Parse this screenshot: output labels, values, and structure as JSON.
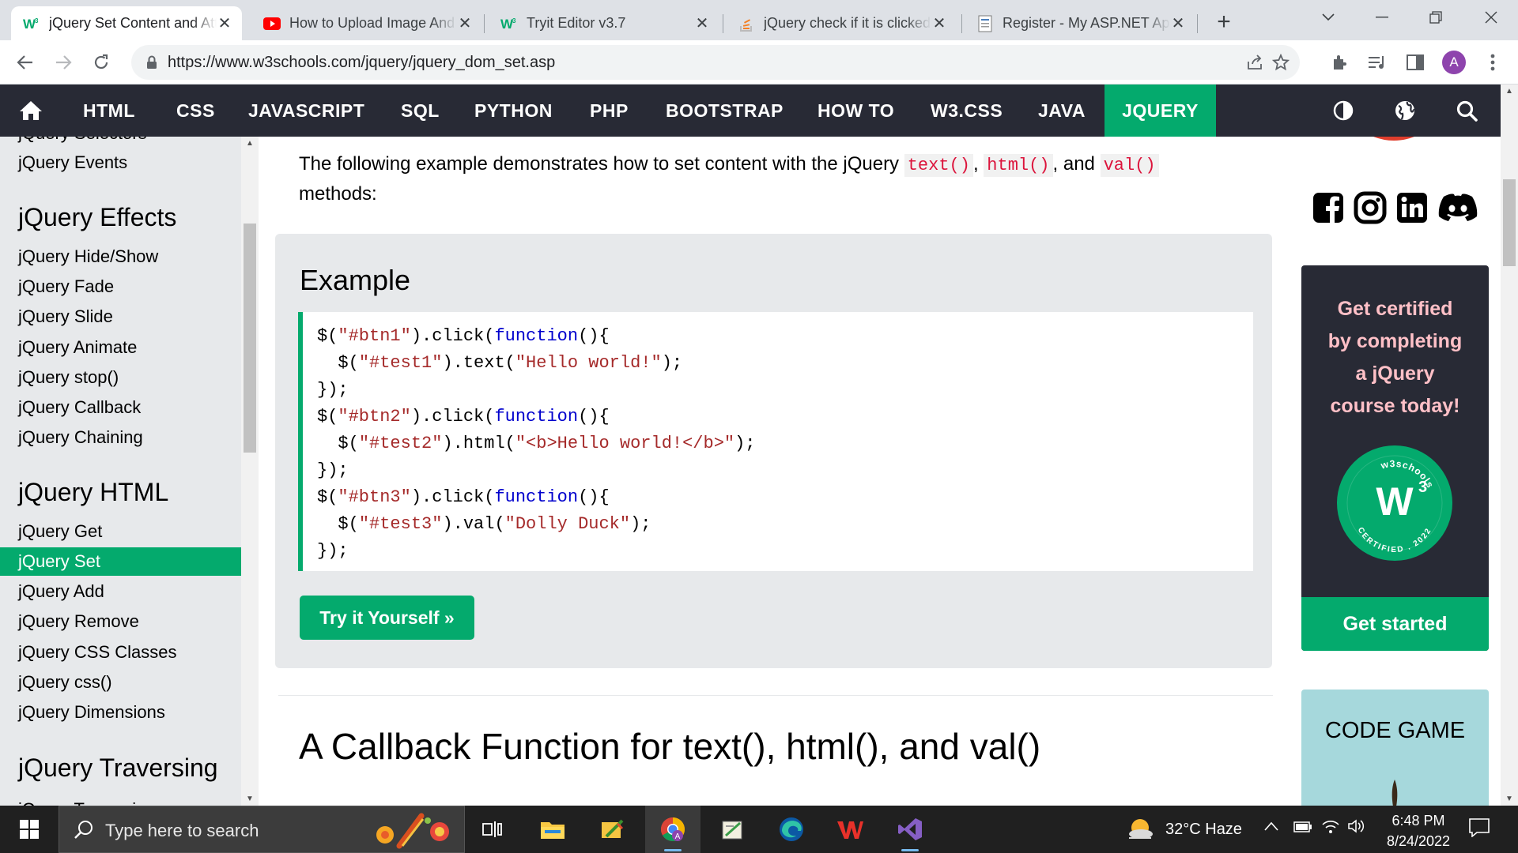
{
  "browser": {
    "tabs": [
      {
        "title": "jQuery Set Content and Attributes",
        "active": true,
        "favicon": "w3schools-icon"
      },
      {
        "title": "How to Upload Image And Save",
        "active": false,
        "favicon": "youtube-icon"
      },
      {
        "title": "Tryit Editor v3.7",
        "active": false,
        "favicon": "w3schools-icon"
      },
      {
        "title": "jQuery check if it is clicked",
        "active": false,
        "favicon": "stackoverflow-icon"
      },
      {
        "title": "Register - My ASP.NET Application",
        "active": false,
        "favicon": "document-icon"
      }
    ],
    "url": "https://www.w3schools.com/jquery/jquery_dom_set.asp",
    "profile_initial": "A"
  },
  "topnav": {
    "items": [
      "HTML",
      "CSS",
      "JAVASCRIPT",
      "SQL",
      "PYTHON",
      "PHP",
      "BOOTSTRAP",
      "HOW TO",
      "W3.CSS",
      "JAVA",
      "JQUERY"
    ],
    "active": "JQUERY"
  },
  "sidebar": {
    "partial_top": "jQuery Selectors",
    "events": "jQuery Events",
    "effects_heading": "jQuery Effects",
    "effects": [
      "jQuery Hide/Show",
      "jQuery Fade",
      "jQuery Slide",
      "jQuery Animate",
      "jQuery stop()",
      "jQuery Callback",
      "jQuery Chaining"
    ],
    "html_heading": "jQuery HTML",
    "html": [
      "jQuery Get",
      "jQuery Set",
      "jQuery Add",
      "jQuery Remove",
      "jQuery CSS Classes",
      "jQuery css()",
      "jQuery Dimensions"
    ],
    "active": "jQuery Set",
    "traversing_heading": "jQuery Traversing",
    "partial_bottom": "jQuery Traversing"
  },
  "main": {
    "intro_prefix": "The following example demonstrates how to set content with the jQuery ",
    "method1": "text()",
    "method2": "html()",
    "method3": "val()",
    "sep1": ", ",
    "sep2": ", and ",
    "intro_suffix": "methods:",
    "example_title": "Example",
    "code_lines": [
      "$(\"#btn1\").click(function(){",
      "  $(\"#test1\").text(\"Hello world!\");",
      "});",
      "$(\"#btn2\").click(function(){",
      "  $(\"#test2\").html(\"<b>Hello world!</b>\");",
      "});",
      "$(\"#btn3\").click(function(){",
      "  $(\"#test3\").val(\"Dolly Duck\");",
      "});"
    ],
    "try_button": "Try it Yourself »",
    "section_heading": "A Callback Function for text(), html(), and val()"
  },
  "rightcol": {
    "cert_text": "Get certified by completing a jQuery course today!",
    "badge_top": "w3schools",
    "badge_bottom": "CERTIFIED . 2022",
    "cert_button": "Get started",
    "code_game": "CODE GAME"
  },
  "taskbar": {
    "search_placeholder": "Type here to search",
    "weather": "32°C  Haze",
    "time": "6:48 PM",
    "date": "8/24/2022"
  },
  "colors": {
    "w3_green": "#04aa6d",
    "w3_dark": "#282a35",
    "sidebar_bg": "#e7e9eb",
    "code_string": "#a52a2a",
    "code_keyword": "#0000cd",
    "inline_code": "#dc143c",
    "cert_text": "#ffc0c7",
    "code_game_bg": "#a6d8dc"
  }
}
